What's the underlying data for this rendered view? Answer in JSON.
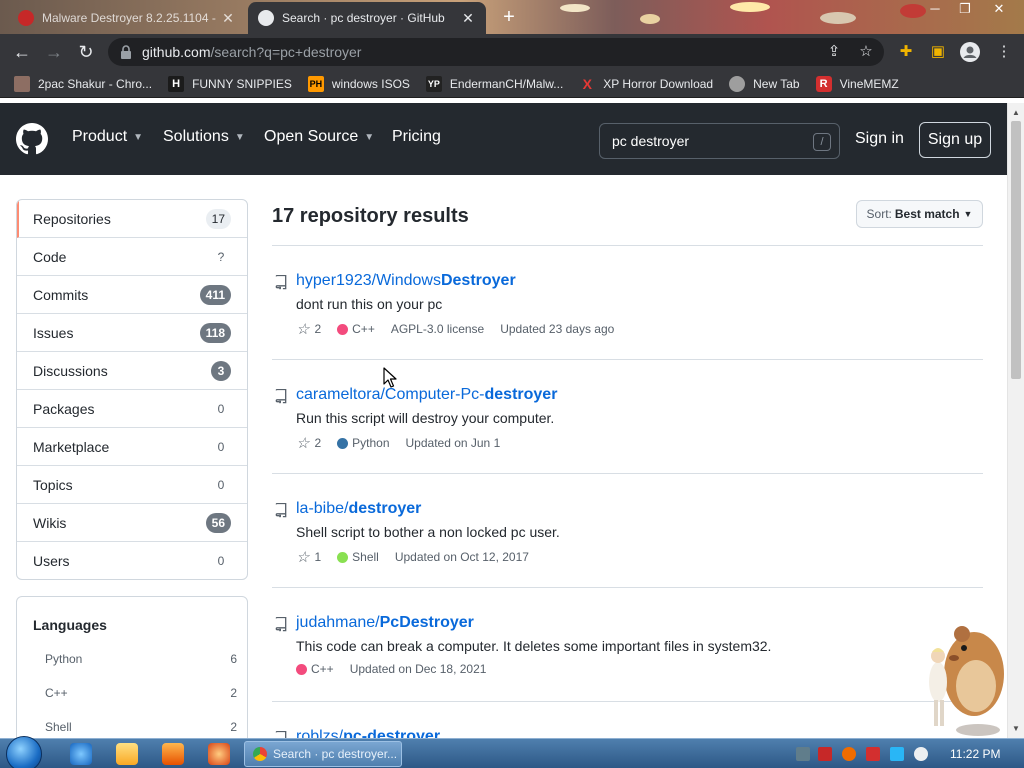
{
  "browser": {
    "tabs": [
      {
        "title": "Malware Destroyer 8.2.25.1104 -",
        "active": false
      },
      {
        "title": "Search · pc destroyer · GitHub",
        "active": true
      }
    ],
    "url_host": "github.com",
    "url_path": "/search?q=pc+destroyer",
    "bookmarks": [
      {
        "label": "2pac Shakur - Chro...",
        "icon": "2pac-favicon"
      },
      {
        "label": "FUNNY SNIPPIES",
        "icon": "H",
        "icon_color": "#ffffff",
        "icon_bg": "#1b1b1b"
      },
      {
        "label": "windows ISOS",
        "icon": "PH",
        "icon_color": "#000000",
        "icon_bg": "#ff9900"
      },
      {
        "label": "EndermanCH/Malw...",
        "icon": "YP",
        "icon_color": "#ffffff",
        "icon_bg": "#222222"
      },
      {
        "label": "XP Horror Download",
        "icon": "X",
        "icon_color": "#e53935",
        "icon_bg": "transparent"
      },
      {
        "label": "New Tab",
        "icon": "globe-icon"
      },
      {
        "label": "VineMEMZ",
        "icon": "R",
        "icon_color": "#ffffff",
        "icon_bg": "#d32f2f"
      }
    ]
  },
  "header": {
    "nav": [
      {
        "label": "Product",
        "dropdown": true
      },
      {
        "label": "Solutions",
        "dropdown": true
      },
      {
        "label": "Open Source",
        "dropdown": true
      },
      {
        "label": "Pricing",
        "dropdown": false
      }
    ],
    "search_value": "pc destroyer",
    "search_shortcut": "/",
    "sign_in": "Sign in",
    "sign_up": "Sign up"
  },
  "sidebar": {
    "filters": [
      {
        "label": "Repositories",
        "count": "17",
        "style": "light",
        "selected": true
      },
      {
        "label": "Code",
        "count": "?",
        "style": "plain",
        "selected": false
      },
      {
        "label": "Commits",
        "count": "411",
        "style": "dark",
        "selected": false
      },
      {
        "label": "Issues",
        "count": "118",
        "style": "dark",
        "selected": false
      },
      {
        "label": "Discussions",
        "count": "3",
        "style": "dark",
        "selected": false
      },
      {
        "label": "Packages",
        "count": "0",
        "style": "plain",
        "selected": false
      },
      {
        "label": "Marketplace",
        "count": "0",
        "style": "plain",
        "selected": false
      },
      {
        "label": "Topics",
        "count": "0",
        "style": "plain",
        "selected": false
      },
      {
        "label": "Wikis",
        "count": "56",
        "style": "dark",
        "selected": false
      },
      {
        "label": "Users",
        "count": "0",
        "style": "plain",
        "selected": false
      }
    ],
    "languages_title": "Languages",
    "languages": [
      {
        "name": "Python",
        "count": "6"
      },
      {
        "name": "C++",
        "count": "2"
      },
      {
        "name": "Shell",
        "count": "2"
      }
    ]
  },
  "results": {
    "title": "17 repository results",
    "sort_label": "Sort:",
    "sort_value": "Best match",
    "repos": [
      {
        "owner": "hyper1923/",
        "name_plain": "Windows",
        "name_hl": "Destroyer",
        "description": "dont run this on your pc",
        "stars": "2",
        "language": "C++",
        "lang_color": "#f34b7d",
        "license": "AGPL-3.0 license",
        "updated": "Updated 23 days ago"
      },
      {
        "owner": "carameltora/",
        "name_plain": "Computer-Pc-",
        "name_hl": "destroyer",
        "description": "Run this script will destroy your computer.",
        "stars": "2",
        "language": "Python",
        "lang_color": "#3572a5",
        "license": "",
        "updated": "Updated on Jun 1"
      },
      {
        "owner": "la-bibe/",
        "name_plain": "",
        "name_hl": "destroyer",
        "description": "Shell script to bother a non locked pc user.",
        "stars": "1",
        "language": "Shell",
        "lang_color": "#89e051",
        "license": "",
        "updated": "Updated on Oct 12, 2017"
      },
      {
        "owner": "judahmane/",
        "name_plain": "",
        "name_hl": "PcDestroyer",
        "description": "This code can break a computer. It deletes some important files in system32.",
        "stars": "",
        "language": "C++",
        "lang_color": "#f34b7d",
        "license": "",
        "updated": "Updated on Dec 18, 2021"
      },
      {
        "owner": "roblzs/",
        "name_plain": "",
        "name_hl": "pc-destroyer",
        "description": "",
        "stars": "",
        "language": "",
        "lang_color": "",
        "license": "",
        "updated": ""
      }
    ]
  },
  "taskbar": {
    "task_title": "Search · pc destroyer...",
    "clock": "11:22 PM"
  }
}
